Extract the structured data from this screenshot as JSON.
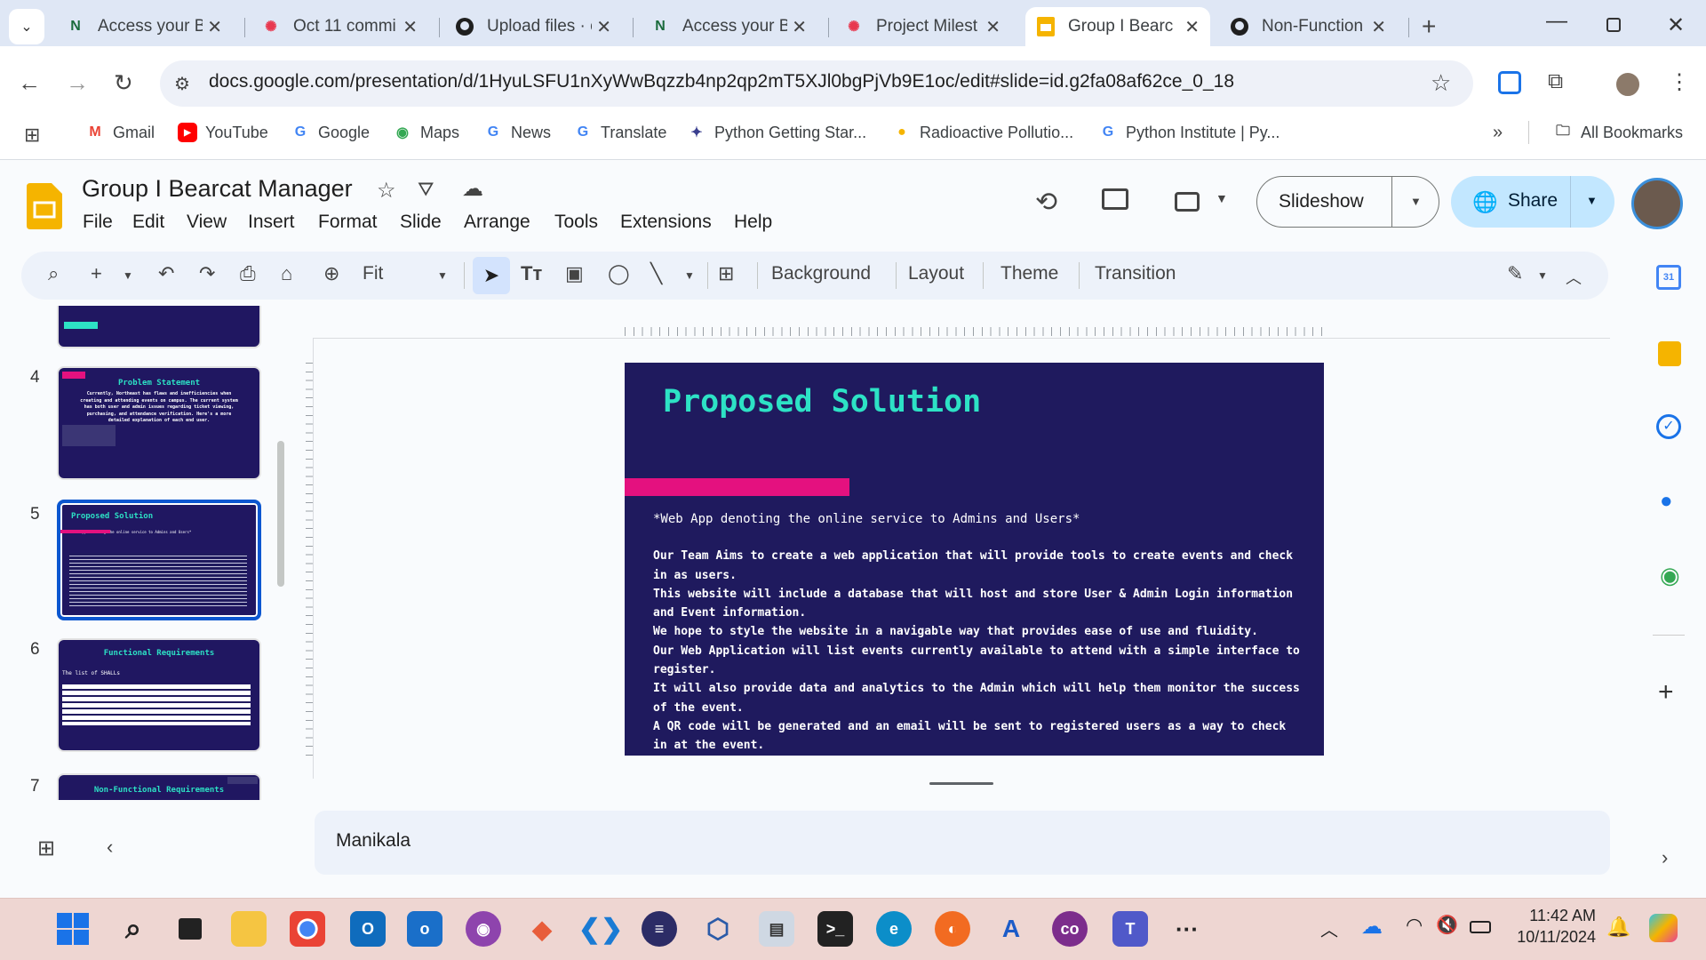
{
  "browser": {
    "tabs": [
      {
        "label": "Access your B",
        "icon": "northeastern-icon"
      },
      {
        "label": "Oct 11 commi",
        "icon": "asana-icon"
      },
      {
        "label": "Upload files · c",
        "icon": "github-icon"
      },
      {
        "label": "Access your B",
        "icon": "northeastern-icon"
      },
      {
        "label": "Project Milest",
        "icon": "asana-icon"
      },
      {
        "label": "Group I Bearc",
        "icon": "slides-icon"
      },
      {
        "label": "Non-Function",
        "icon": "github-icon"
      }
    ],
    "url": "docs.google.com/presentation/d/1HyuLSFU1nXyWwBqzzb4np2qp2mT5XJl0bgPjVb9E1oc/edit#slide=id.g2fa08af62ce_0_18",
    "bookmarks": [
      {
        "label": "Gmail"
      },
      {
        "label": "YouTube"
      },
      {
        "label": "Google"
      },
      {
        "label": "Maps"
      },
      {
        "label": "News"
      },
      {
        "label": "Translate"
      },
      {
        "label": "Python Getting Star..."
      },
      {
        "label": "Radioactive Pollutio..."
      },
      {
        "label": "Python Institute | Py..."
      }
    ],
    "all_bookmarks": "All Bookmarks"
  },
  "doc": {
    "title": "Group I Bearcat Manager",
    "menu": [
      "File",
      "Edit",
      "View",
      "Insert",
      "Format",
      "Slide",
      "Arrange",
      "Tools",
      "Extensions",
      "Help"
    ],
    "slideshow": "Slideshow",
    "share": "Share",
    "zoom": "Fit",
    "toolbar_text": [
      "Background",
      "Layout",
      "Theme",
      "Transition"
    ]
  },
  "filmstrip": [
    {
      "num": "4",
      "title": "Problem Statement",
      "body": "Currently, Northeast has flaws and inefficiencies when creating and attending events on campus. The current system has both user and admin issues regarding ticket viewing, purchasing, and attendance verification. Here's a more detailed explanation of each end user."
    },
    {
      "num": "5",
      "title": "Proposed Solution",
      "body": "*Web App denoting the online service to Admins and Users*"
    },
    {
      "num": "6",
      "title": "Functional Requirements",
      "body": "The list of SHALLs"
    },
    {
      "num": "7",
      "title": "Non-Functional Requirements",
      "body": ""
    }
  ],
  "slide": {
    "title": "Proposed Solution",
    "subtitle": "*Web App denoting the online service to Admins and Users*",
    "lines": [
      "Our Team Aims to create a web application that will provide tools to create events and check in as users.",
      "This website will include a database that will host and store User & Admin Login information and Event information.",
      "We hope to style the website in a navigable way that provides ease of use and fluidity.",
      "Our Web Application will list events currently available to attend with a simple interface to register.",
      "It will also provide data and analytics to the Admin which will help them monitor the success of the event.",
      "A QR code will be generated and an email will be sent to registered users as a way to check in at the event."
    ]
  },
  "notes": {
    "text": "Manikala"
  },
  "taskbar": {
    "time": "11:42 AM",
    "date": "10/11/2024"
  },
  "colors": {
    "slide_bg": "#1f1a5e",
    "slide_title": "#2de2c5",
    "accent_pink": "#e4117f",
    "share_bg": "#c2e7ff"
  }
}
